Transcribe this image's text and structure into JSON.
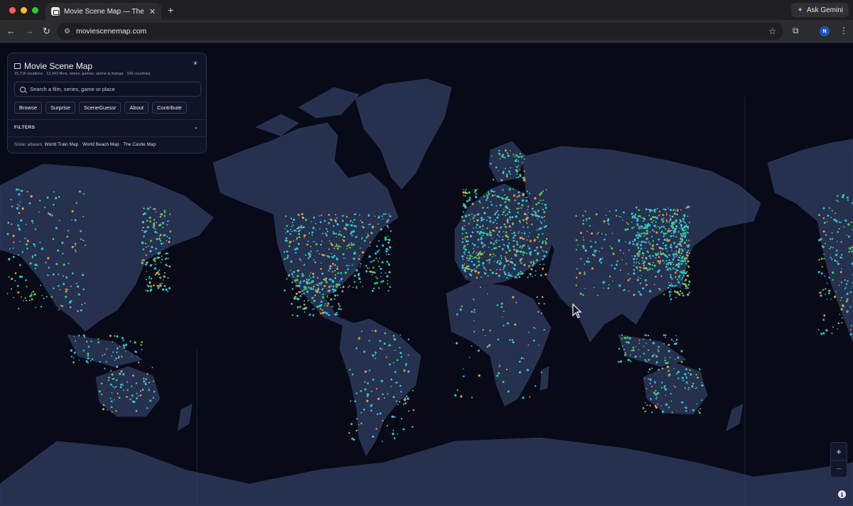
{
  "browser": {
    "tab_title": "Movie Scene Map — The Film",
    "tab_close": "✕",
    "new_tab": "+",
    "url": "moviescenemap.com",
    "gemini_label": "Ask Gemini",
    "profile_initial": "N"
  },
  "panel": {
    "title": "Movie Scene Map",
    "subtitle": "15,716 locations · 13,343 films, series, games, anime & manga · 166 countries",
    "search_placeholder": "Search a film, series, game or place",
    "buttons": [
      "Browse",
      "Surprise",
      "SceneGuessr",
      "About",
      "Contribute"
    ],
    "filters_label": "FILTERS",
    "sister_prefix": "Sister atlases:",
    "sister_links": [
      "World Train Map",
      "World Beach Map",
      "The Castle Map"
    ],
    "sister_sep": "·"
  },
  "map_controls": {
    "zoom_in": "+",
    "zoom_out": "−",
    "info": "i"
  },
  "colors": {
    "map_bg": "#090a18",
    "land": "#26304f",
    "marker_cyan": "#2fc4d8",
    "marker_green": "#3ccf4a",
    "marker_orange": "#e89a3c"
  }
}
